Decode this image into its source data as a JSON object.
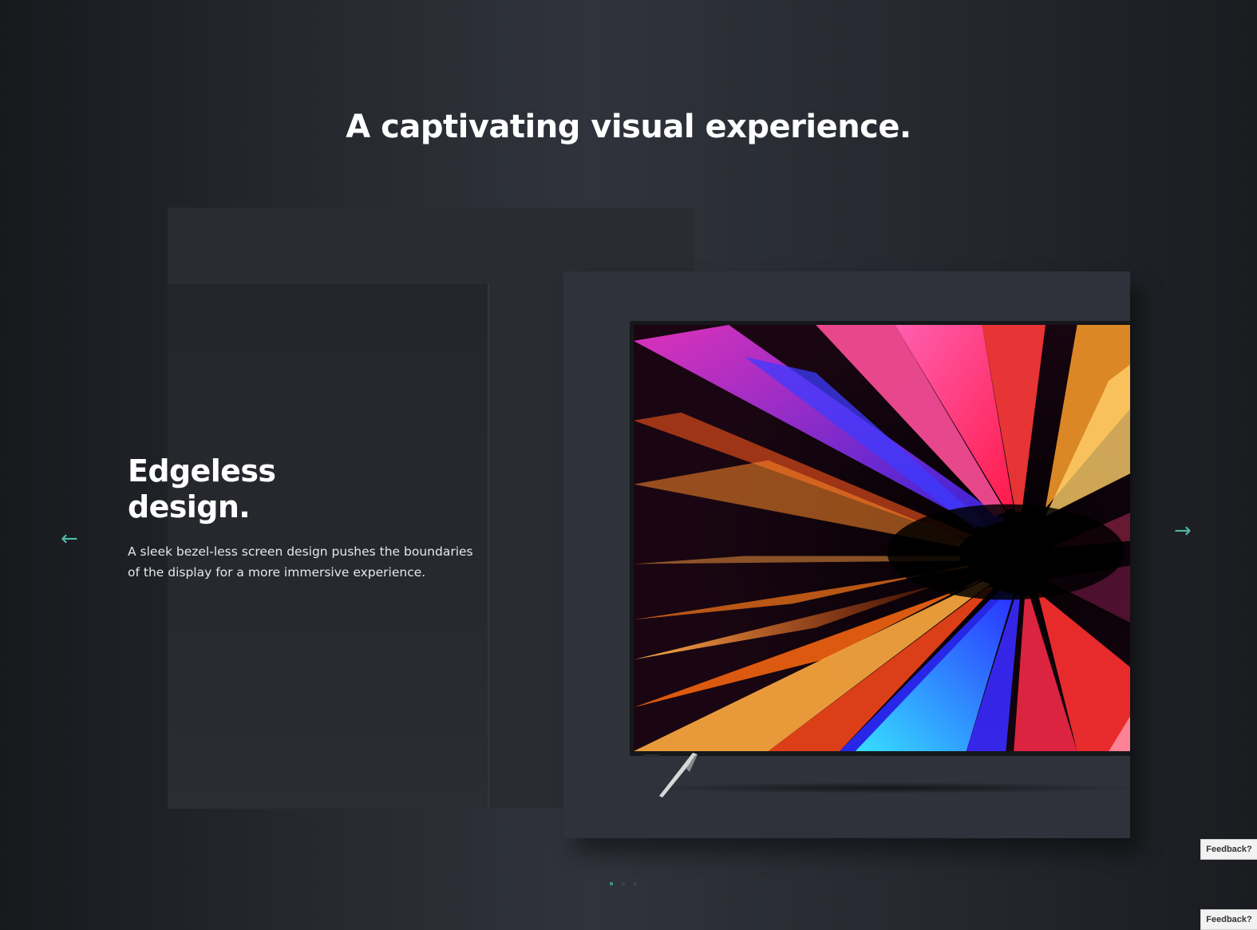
{
  "headline": "A captivating visual experience.",
  "slide": {
    "title": "Edgeless\ndesign.",
    "description": "A sleek bezel-less screen design pushes the boundaries of the display for a more immersive experience."
  },
  "nav": {
    "prev_icon": "←",
    "next_icon": "→",
    "prev_icon_name": "arrow-left-icon",
    "next_icon_name": "arrow-right-icon"
  },
  "pagination": {
    "count": 3,
    "active": 1
  },
  "feedback": {
    "label_1": "Feedback?",
    "label_2": "Feedback?"
  },
  "colors": {
    "accent": "#4fb8a6",
    "background": "#24272d",
    "card": "#2f323b"
  }
}
